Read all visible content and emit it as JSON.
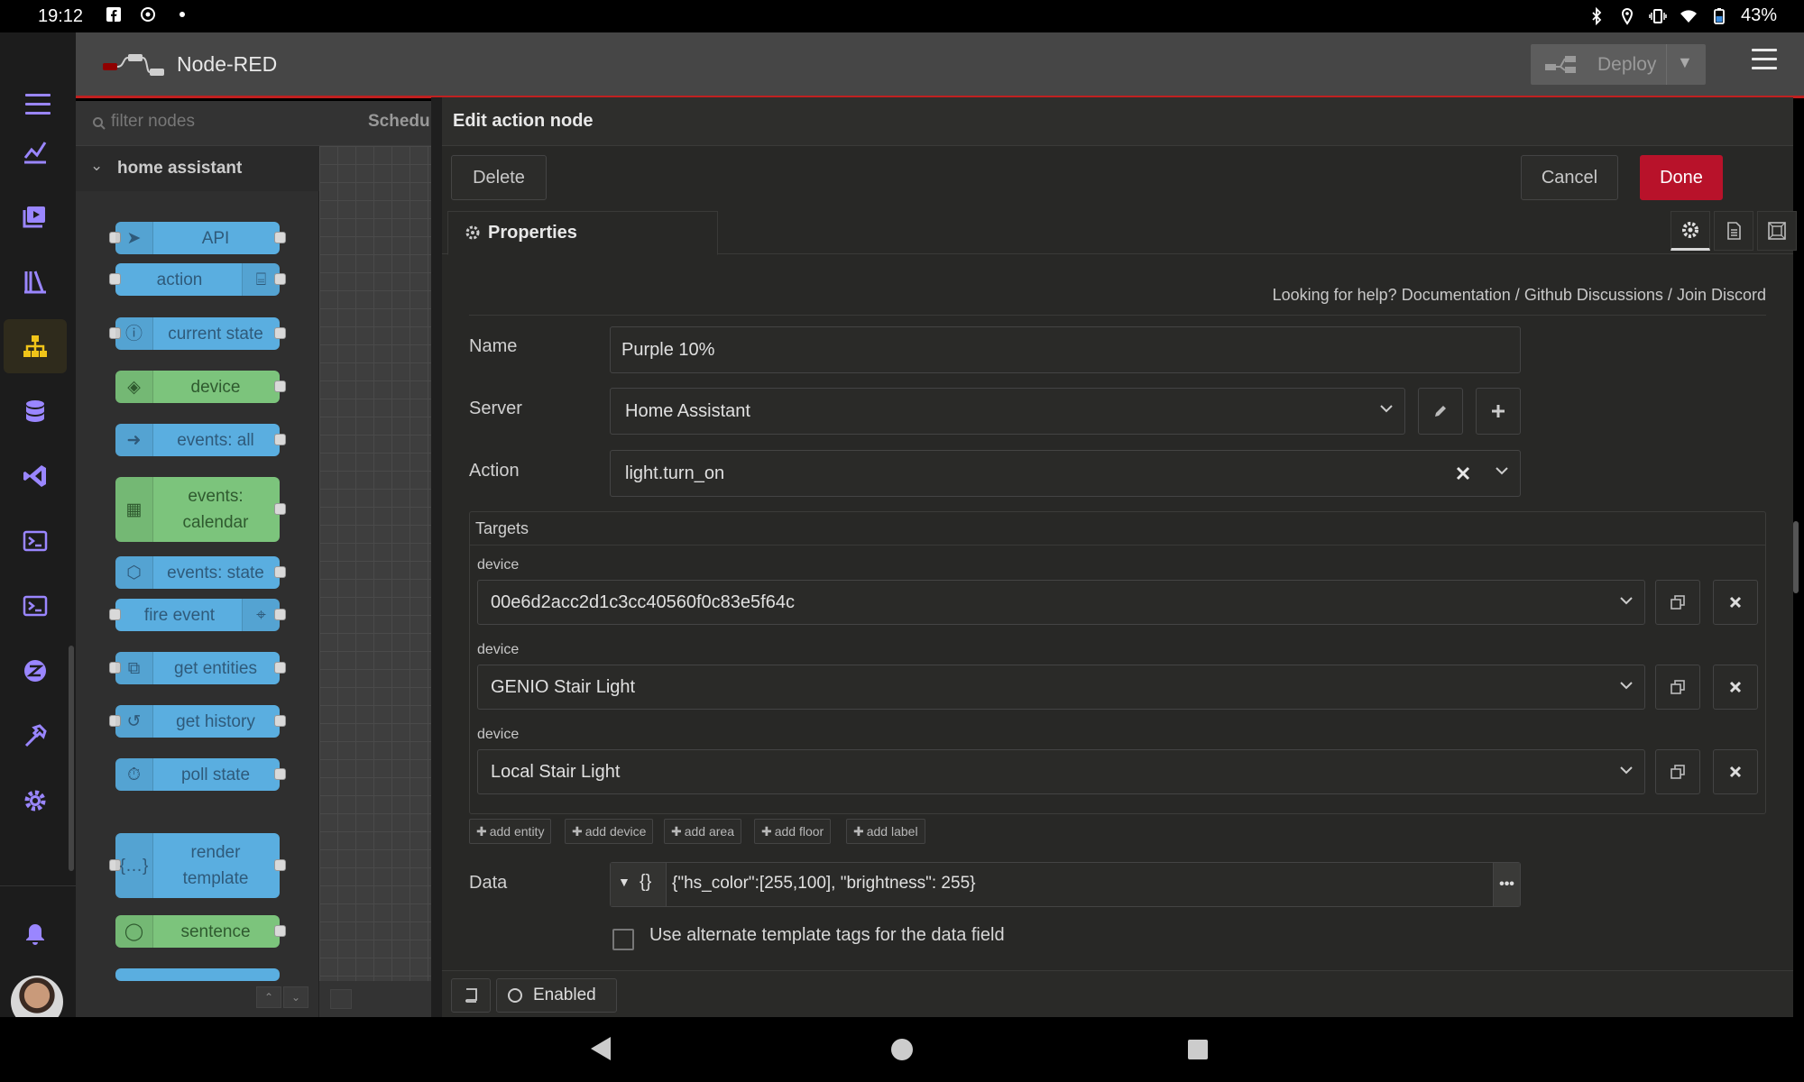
{
  "status_bar": {
    "time": "19:12",
    "battery": "43%"
  },
  "app": {
    "title": "Node-RED",
    "deploy_label": "Deploy"
  },
  "palette": {
    "filter_placeholder": "filter nodes",
    "category": "home assistant",
    "nodes": [
      {
        "label": "API",
        "color": "#5aaee0",
        "icon": "send-icon"
      },
      {
        "label": "action",
        "color": "#5aaee0",
        "icon": "router-icon"
      },
      {
        "label": "current state",
        "color": "#5aaee0",
        "icon": "info-icon"
      },
      {
        "label": "device",
        "color": "#7cc47c",
        "icon": "cube-icon"
      },
      {
        "label": "events: all",
        "color": "#5aaee0",
        "icon": "arrow-right-icon"
      },
      {
        "label": "events: calendar",
        "color": "#7cc47c",
        "icon": "calendar-icon"
      },
      {
        "label": "events: state",
        "color": "#5aaee0",
        "icon": "hexagon-icon"
      },
      {
        "label": "fire event",
        "color": "#5aaee0",
        "icon": "broadcast-icon"
      },
      {
        "label": "get entities",
        "color": "#5aaee0",
        "icon": "entities-icon"
      },
      {
        "label": "get history",
        "color": "#5aaee0",
        "icon": "history-icon"
      },
      {
        "label": "poll state",
        "color": "#5aaee0",
        "icon": "timer-icon"
      },
      {
        "label": "render template",
        "color": "#5aaee0",
        "icon": "braces-icon"
      },
      {
        "label": "sentence",
        "color": "#7cc47c",
        "icon": "speech-icon"
      }
    ]
  },
  "workspace": {
    "tab_label": "Schedu"
  },
  "tray": {
    "title": "Edit action node",
    "delete_label": "Delete",
    "cancel_label": "Cancel",
    "done_label": "Done",
    "tab_label": "Properties",
    "help": {
      "prefix": "Looking for help?",
      "documentation": "Documentation",
      "sep": "/",
      "github": "Github Discussions",
      "discord": "Join Discord"
    },
    "fields": {
      "name_label": "Name",
      "name_value": "Purple 10%",
      "server_label": "Server",
      "server_value": "Home Assistant",
      "action_label": "Action",
      "action_value": "light.turn_on",
      "targets_label": "Targets",
      "device_label": "device",
      "devices": [
        "00e6d2acc2d1c3cc40560f0c83e5f64c",
        "GENIO Stair Light",
        "Local Stair Light"
      ],
      "add_buttons": [
        "add entity",
        "add device",
        "add area",
        "add floor",
        "add label"
      ],
      "data_label": "Data",
      "data_type": "{}",
      "data_value": "{\"hs_color\":[255,100], \"brightness\": 255}",
      "alt_template_label": "Use alternate template tags for the data field"
    },
    "footer": {
      "enabled_label": "Enabled"
    }
  },
  "colors": {
    "done": "#b8122a",
    "ha_accent": "#9a86ff",
    "node_blue": "#5aaee0",
    "node_green": "#7cc47c"
  }
}
